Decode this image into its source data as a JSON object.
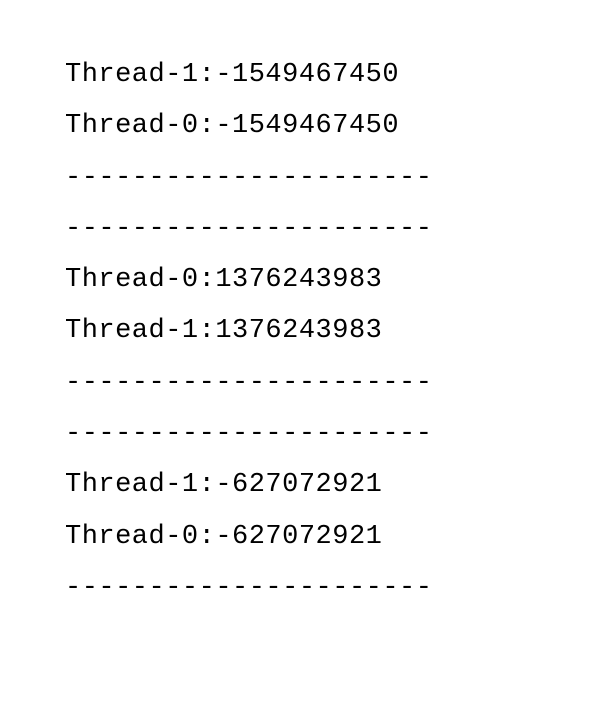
{
  "lines": [
    "Thread-1:-1549467450",
    "Thread-0:-1549467450",
    "----------------------",
    "----------------------",
    "Thread-0:1376243983",
    "Thread-1:1376243983",
    "----------------------",
    "----------------------",
    "Thread-1:-627072921",
    "Thread-0:-627072921",
    "----------------------"
  ]
}
